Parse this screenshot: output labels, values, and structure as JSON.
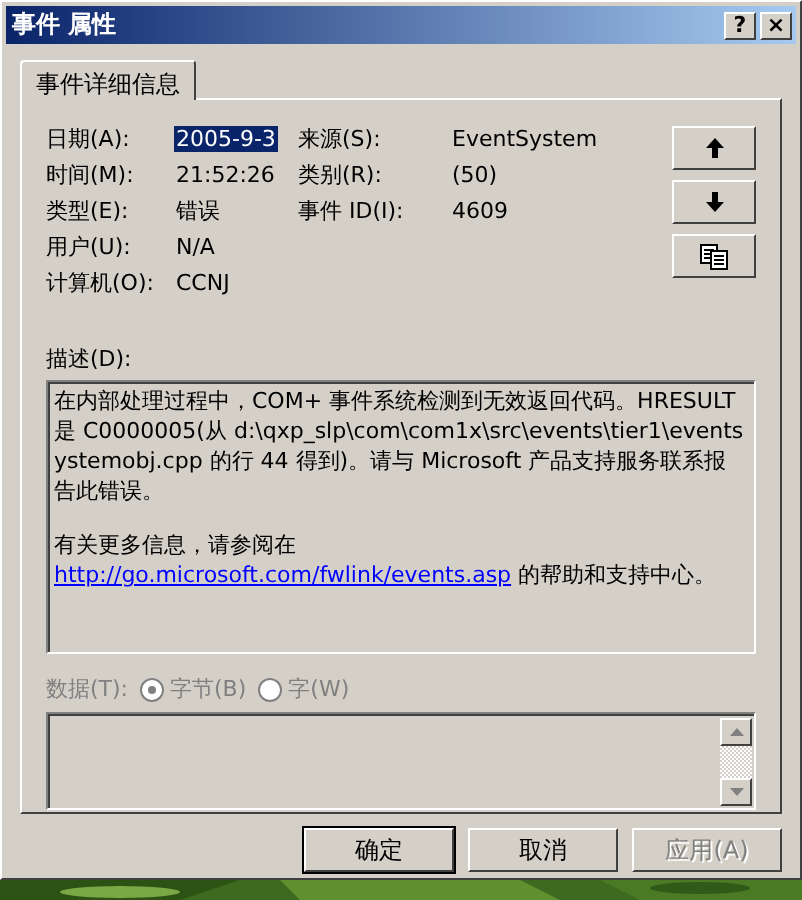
{
  "window": {
    "title": "事件 属性",
    "controls": [
      {
        "kind": "help",
        "label": "?"
      },
      {
        "kind": "close",
        "label": "×"
      }
    ]
  },
  "tabs": [
    {
      "label": "事件详细信息",
      "selected": true
    }
  ],
  "fields": [
    [
      {
        "label": "日期(A):",
        "value": "2005-9-3",
        "highlighted": true
      },
      {
        "label": "来源(S):",
        "value": "EventSystem",
        "highlighted": false
      }
    ],
    [
      {
        "label": "时间(M):",
        "value": "21:52:26",
        "highlighted": false
      },
      {
        "label": "类别(R):",
        "value": "(50)",
        "highlighted": false
      }
    ],
    [
      {
        "label": "类型(E):",
        "value": "错误",
        "highlighted": false
      },
      {
        "label": "事件 ID(I):",
        "value": "4609",
        "highlighted": false
      }
    ],
    [
      {
        "label": "用户(U):",
        "value": "N/A",
        "highlighted": false
      }
    ],
    [
      {
        "label": "计算机(O):",
        "value": "CCNJ",
        "highlighted": false
      }
    ]
  ],
  "side_buttons": [
    {
      "kind": "up"
    },
    {
      "kind": "down"
    },
    {
      "kind": "copy"
    }
  ],
  "description": {
    "label": "描述(D):",
    "paragraphs": [
      {
        "text": "在内部处理过程中，COM+ 事件系统检测到无效返回代码。HRESULT 是 C0000005(从 d:\\qxp_slp\\com\\com1x\\src\\events\\tier1\\eventsystemobj.cpp 的行 44 得到)。请与 Microsoft 产品支持服务联系报告此错误。"
      },
      {
        "text": "有关更多信息，请参阅在",
        "link": "http://go.microsoft.com/fwlink/events.asp",
        "after": " 的帮助和支持中心。"
      }
    ]
  },
  "data": {
    "label": "数据(T):",
    "disabled": true,
    "options": [
      {
        "label": "字节(B)",
        "selected": true
      },
      {
        "label": "字(W)",
        "selected": false
      }
    ]
  },
  "buttons": [
    {
      "label": "确定",
      "default": true,
      "disabled": false
    },
    {
      "label": "取消",
      "default": false,
      "disabled": false
    },
    {
      "label": "应用(A)",
      "default": false,
      "disabled": true
    }
  ]
}
